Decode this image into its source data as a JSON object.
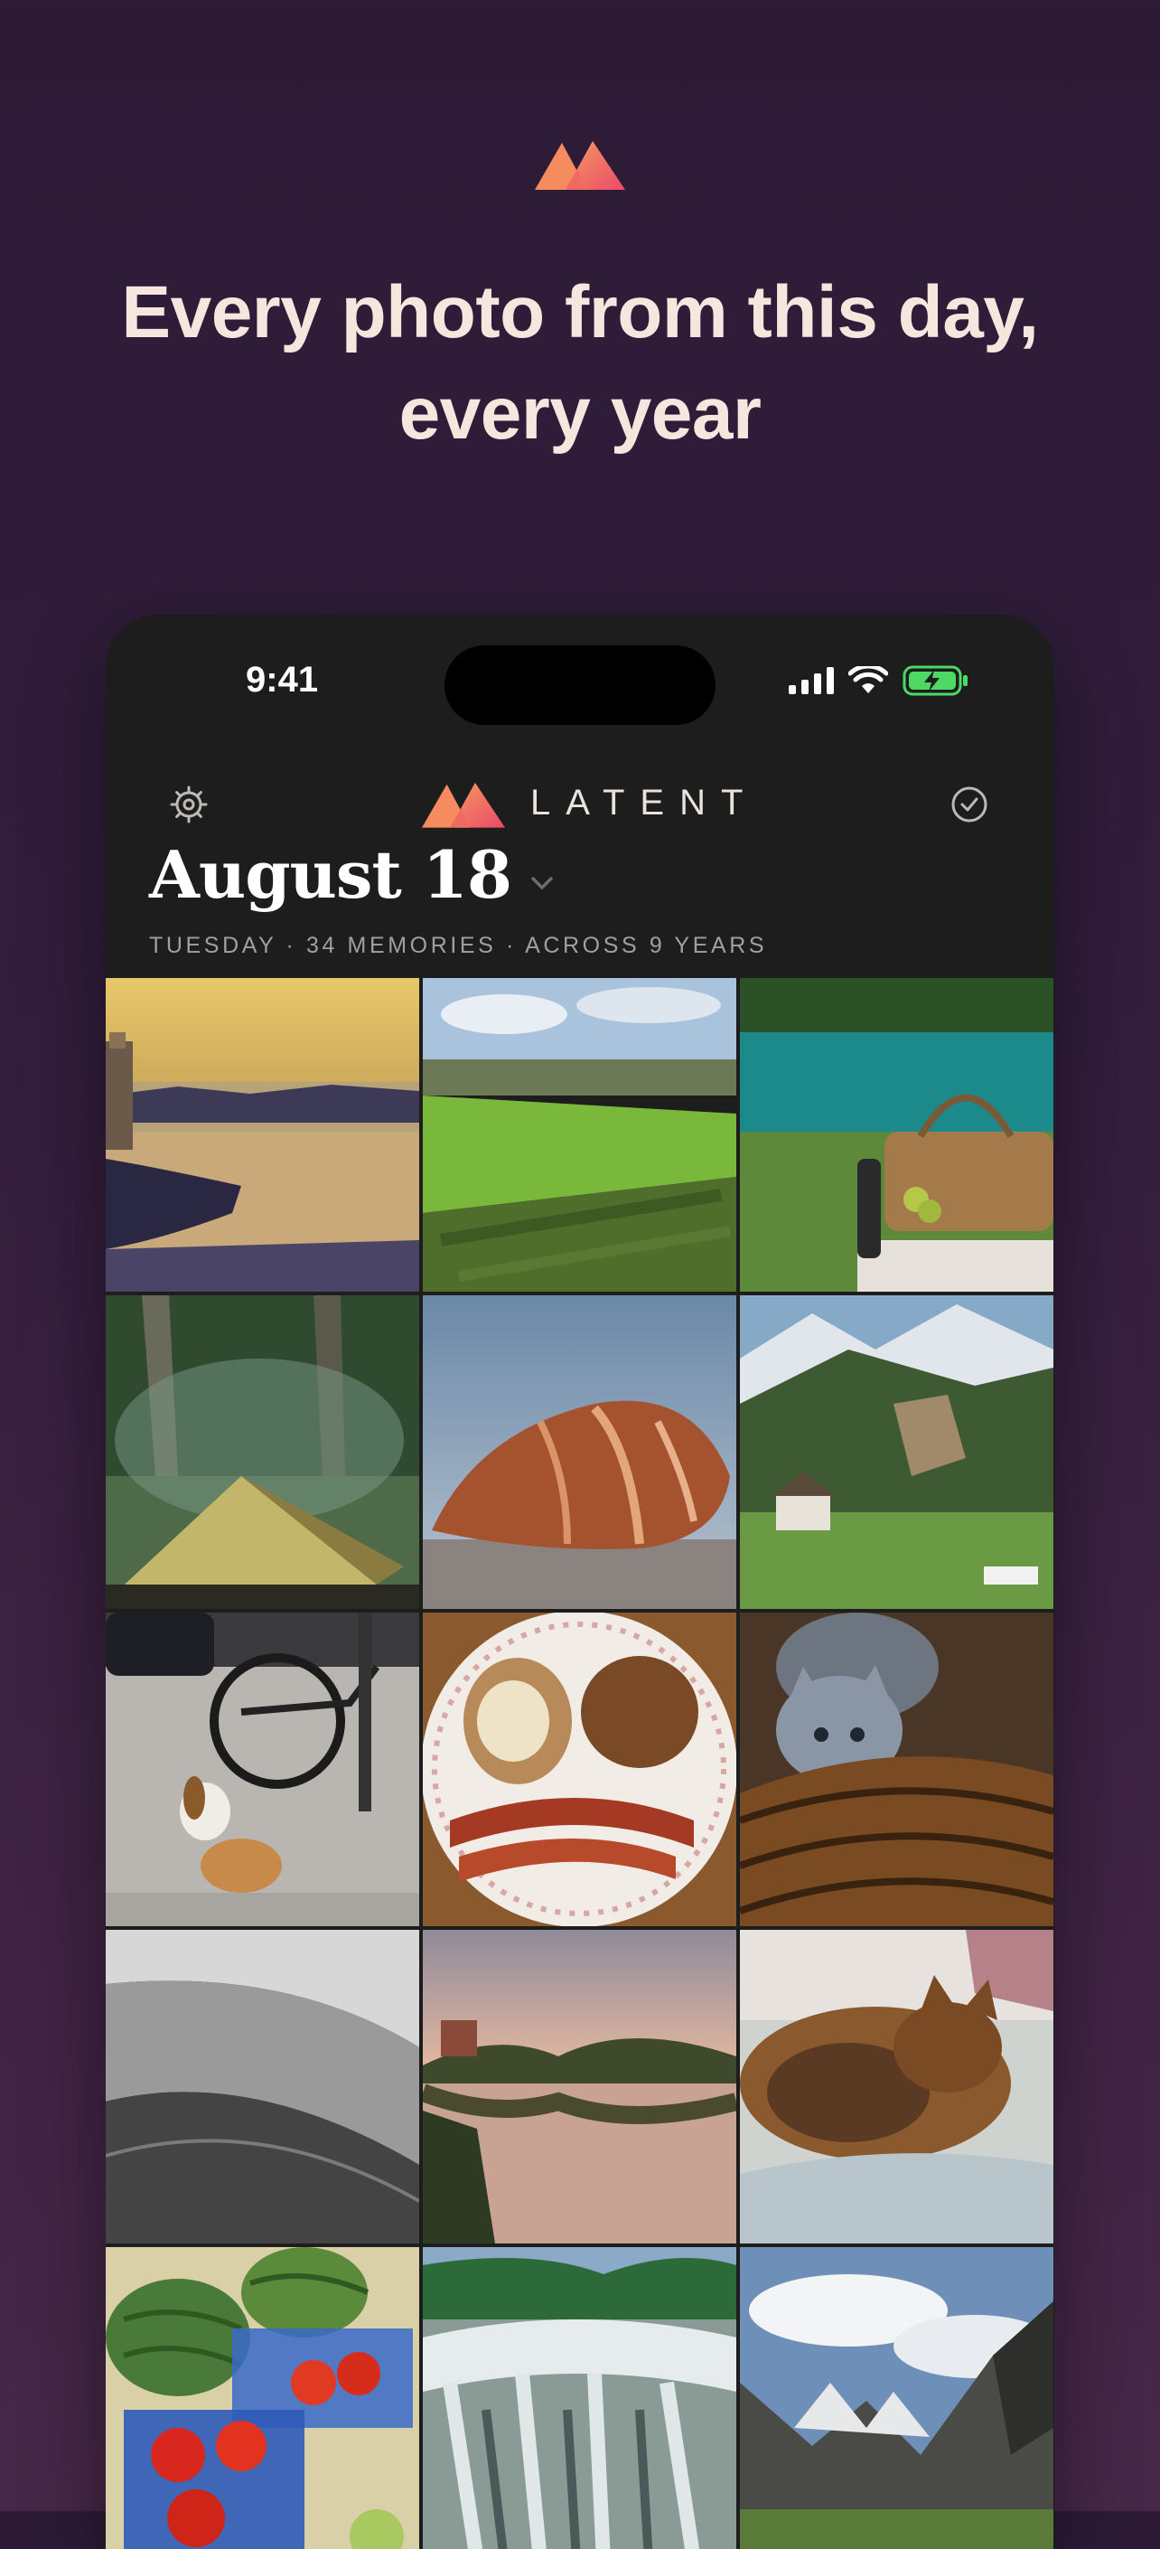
{
  "hero": {
    "logo_icon": "latent-mountains-logo",
    "headline_line1": "Every photo from this day,",
    "headline_line2": "every year"
  },
  "status_bar": {
    "time": "9:41",
    "icons": [
      "signal-icon",
      "wifi-icon",
      "battery-charging-icon"
    ]
  },
  "app": {
    "brand": "LATENT",
    "settings_icon": "gear-icon",
    "select_icon": "checkmark-circle-icon",
    "date_title": "August 18",
    "date_picker_icon": "chevron-down-icon",
    "subtitle": "TUESDAY · 34 MEMORIES · ACROSS 9 YEARS"
  },
  "photos": [
    "lighthouse-harbor",
    "green-field-village",
    "lake-picnic-basket",
    "forest-tent",
    "seashell",
    "mountain-valley",
    "beagle-bicycle",
    "breakfast-plate",
    "kitten-basket",
    "sand-dunes",
    "sunset-lake",
    "sleeping-cat",
    "watermelon-tomatoes",
    "waterfall",
    "alpine-peaks"
  ],
  "colors": {
    "background": "#2d1b36",
    "headline": "#f6e6de",
    "accent_start": "#f5835f",
    "accent_end": "#e8486a",
    "battery_green": "#4cd964"
  }
}
